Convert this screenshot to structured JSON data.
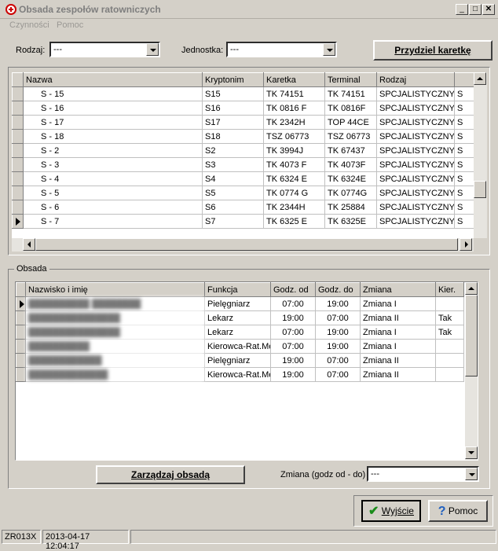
{
  "window": {
    "title": "Obsada zespołów ratowniczych"
  },
  "menu": [
    "Czynności",
    "Pomoc"
  ],
  "filters": {
    "rodzaj_label": "Rodzaj:",
    "rodzaj_value": "---",
    "jednostka_label": "Jednostka:",
    "jednostka_value": "---"
  },
  "assign_button": "Przydziel karetkę",
  "teams": {
    "columns": [
      "Nazwa",
      "Kryptonim",
      "Karetka",
      "Terminal",
      "Rodzaj"
    ],
    "rows": [
      [
        "S - 15",
        "S15",
        "TK 74151",
        "TK 74151",
        "SPCJALISTYCZNY",
        "S"
      ],
      [
        "S - 16",
        "S16",
        "TK 0816 F",
        "TK 0816F",
        "SPCJALISTYCZNY",
        "S"
      ],
      [
        "S - 17",
        "S17",
        "TK 2342H",
        "TOP 44CE",
        "SPCJALISTYCZNY",
        "S"
      ],
      [
        "S - 18",
        "S18",
        "TSZ 06773",
        "TSZ 06773",
        "SPCJALISTYCZNY",
        "S"
      ],
      [
        "S - 2",
        "S2",
        "TK 3994J",
        "TK 67437",
        "SPCJALISTYCZNY",
        "S"
      ],
      [
        "S - 3",
        "S3",
        "TK 4073 F",
        "TK 4073F",
        "SPCJALISTYCZNY",
        "S"
      ],
      [
        "S - 4",
        "S4",
        "TK 6324 E",
        "TK 6324E",
        "SPCJALISTYCZNY",
        "S"
      ],
      [
        "S - 5",
        "S5",
        "TK 0774 G",
        "TK 0774G",
        "SPCJALISTYCZNY",
        "S"
      ],
      [
        "S - 6",
        "S6",
        "TK 2344H",
        "TK 25884",
        "SPCJALISTYCZNY",
        "S"
      ],
      [
        "S - 7",
        "S7",
        "TK 6325 E",
        "TK 6325E",
        "SPCJALISTYCZNY",
        "S"
      ]
    ],
    "current_row": 9
  },
  "crew": {
    "group_label": "Obsada",
    "columns": [
      "Nazwisko i imię",
      "Funkcja",
      "Godz. od",
      "Godz. do",
      "Zmiana",
      "Kier."
    ],
    "rows": [
      [
        "██████████ ████████",
        "Pielęgniarz",
        "07:00",
        "19:00",
        "Zmiana I",
        ""
      ],
      [
        "███████████████",
        "Lekarz",
        "19:00",
        "07:00",
        "Zmiana II",
        "Tak"
      ],
      [
        "███████████████",
        "Lekarz",
        "07:00",
        "19:00",
        "Zmiana I",
        "Tak"
      ],
      [
        "██████████",
        "Kierowca-Rat.Me",
        "07:00",
        "19:00",
        "Zmiana I",
        ""
      ],
      [
        "████████████",
        "Pielęgniarz",
        "19:00",
        "07:00",
        "Zmiana II",
        ""
      ],
      [
        "█████████████",
        "Kierowca-Rat.Me",
        "19:00",
        "07:00",
        "Zmiana II",
        ""
      ]
    ],
    "current_row": 0
  },
  "manage_button": "Zarządzaj obsadą",
  "shift": {
    "label": "Zmiana (godz od - do) :",
    "value": "---"
  },
  "footer": {
    "exit_label": "Wyjście",
    "help_label": "Pomoc"
  },
  "status": {
    "code": "ZR013X",
    "datetime": "2013-04-17 12:04:17"
  },
  "colors": {
    "ok_check": "#1a8c1a",
    "help_mark": "#1f5fbf"
  }
}
